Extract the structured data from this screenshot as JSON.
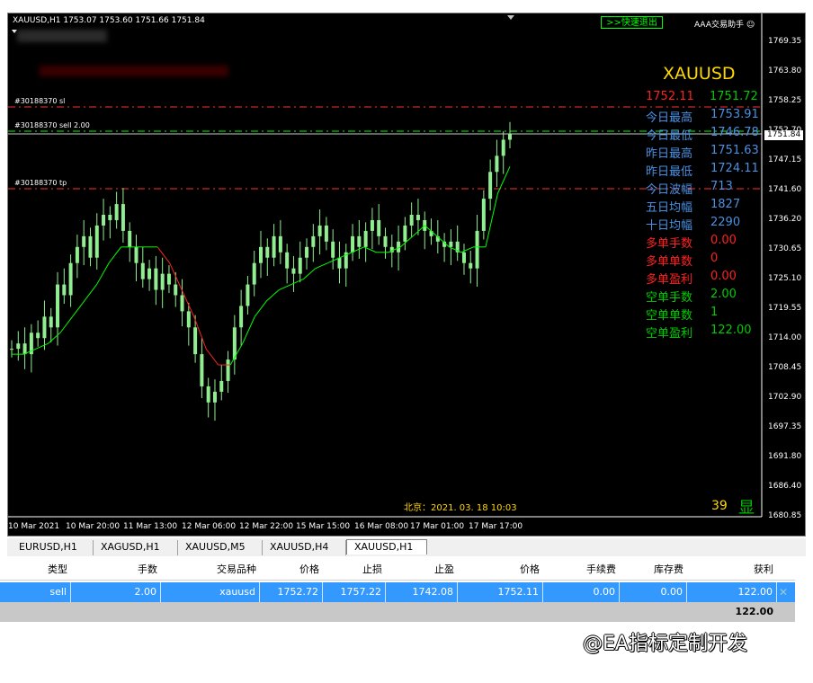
{
  "chart": {
    "header": "XAUUSD,H1  1753.07 1753.60 1751.66 1751.84",
    "quick_exit": ">>快速退出",
    "helper": "AAA交易助手 ☺",
    "symbol_title": "XAUUSD",
    "bid": "1752.11",
    "ask": "1751.72",
    "stats": [
      {
        "label": "今日最高",
        "value": "1753.91",
        "color": "#4a90e2"
      },
      {
        "label": "今日最低",
        "value": "1746.78",
        "color": "#4a90e2"
      },
      {
        "label": "昨日最高",
        "value": "1751.63",
        "color": "#4a90e2"
      },
      {
        "label": "昨日最低",
        "value": "1724.11",
        "color": "#4a90e2"
      },
      {
        "label": "今日波幅",
        "value": "713",
        "color": "#4a90e2"
      },
      {
        "label": "五日均幅",
        "value": "1827",
        "color": "#4a90e2"
      },
      {
        "label": "十日均幅",
        "value": "2290",
        "color": "#4a90e2"
      },
      {
        "label": "多单手数",
        "value": "0.00",
        "color": "#ff2020"
      },
      {
        "label": "多单单数",
        "value": "0",
        "color": "#ff2020"
      },
      {
        "label": "多单盈利",
        "value": "0.00",
        "color": "#ff2020"
      },
      {
        "label": "空单手数",
        "value": "2.00",
        "color": "#00cc00"
      },
      {
        "label": "空单单数",
        "value": "1",
        "color": "#00cc00"
      },
      {
        "label": "空单盈利",
        "value": "122.00",
        "color": "#00cc00"
      }
    ],
    "trade_lines": {
      "sl": "#30188370 sl",
      "sell": "#30188370 sell 2.00",
      "tp": "#30188370 tp"
    },
    "price_ticks": [
      "1769.35",
      "1763.80",
      "1758.25",
      "1752.70",
      "1747.15",
      "1741.60",
      "1736.20",
      "1730.65",
      "1725.10",
      "1719.55",
      "1714.00",
      "1708.45",
      "1702.90",
      "1697.35",
      "1691.80",
      "1686.40",
      "1680.85"
    ],
    "current_price": "1751.84",
    "time_ticks": [
      "10 Mar 2021",
      "10 Mar 20:00",
      "11 Mar 13:00",
      "12 Mar 06:00",
      "12 Mar 22:00",
      "15 Mar 15:00",
      "16 Mar 08:00",
      "17 Mar 01:00",
      "17 Mar 17:00"
    ],
    "beijing_time": "北京：2021. 03. 18  10:03",
    "countdown": "39",
    "show_label": "显"
  },
  "chart_data": {
    "type": "candlestick",
    "close": [
      1712,
      1713,
      1711,
      1715,
      1714,
      1718,
      1716,
      1724,
      1722,
      1728,
      1731,
      1733,
      1729,
      1735,
      1737,
      1736,
      1739,
      1734,
      1731,
      1728,
      1725,
      1727,
      1723,
      1726,
      1724,
      1722,
      1719,
      1716,
      1711,
      1705,
      1702,
      1704,
      1706,
      1710,
      1716,
      1720,
      1724,
      1728,
      1731,
      1729,
      1733,
      1730,
      1727,
      1726,
      1729,
      1731,
      1733,
      1735,
      1732,
      1729,
      1727,
      1730,
      1733,
      1731,
      1734,
      1736,
      1733,
      1731,
      1730,
      1732,
      1735,
      1737,
      1736,
      1734,
      1733,
      1732,
      1731,
      1732,
      1730,
      1728,
      1727,
      1734,
      1740,
      1745,
      1748,
      1751,
      1752
    ],
    "indicator_points_price": [
      1711,
      1711,
      1712,
      1713,
      1715,
      1718,
      1721,
      1724,
      1728,
      1731,
      1731,
      1731,
      1731,
      1728,
      1723,
      1718,
      1712,
      1709,
      1709,
      1713,
      1718,
      1721,
      1723,
      1724,
      1725,
      1727,
      1728,
      1729,
      1730,
      1731,
      1730,
      1730,
      1731,
      1733,
      1735,
      1733,
      1731,
      1730,
      1731,
      1731,
      1741,
      1746
    ],
    "ylim": [
      1680.85,
      1769.35
    ]
  },
  "tabs": [
    "EURUSD,H1",
    "XAGUSD,H1",
    "XAUUSD,M5",
    "XAUUSD,H4",
    "XAUUSD,H1"
  ],
  "active_tab": 4,
  "table": {
    "headers": [
      "类型",
      "手数",
      "交易品种",
      "价格",
      "止损",
      "止盈",
      "价格",
      "手续费",
      "库存费",
      "获利"
    ],
    "row": [
      "sell",
      "2.00",
      "xauusd",
      "1752.72",
      "1757.22",
      "1742.08",
      "1752.11",
      "0.00",
      "0.00",
      "122.00"
    ],
    "total": "122.00"
  },
  "watermark": "@EA指标定制开发"
}
